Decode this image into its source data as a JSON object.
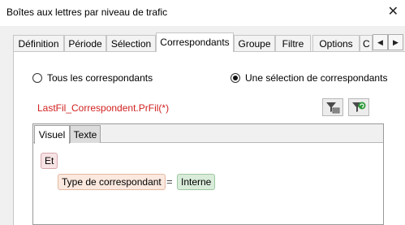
{
  "window": {
    "title": "Boîtes aux lettres par niveau de trafic",
    "close_glyph": "✕"
  },
  "tabs": [
    {
      "label": "Définition"
    },
    {
      "label": "Période"
    },
    {
      "label": "Sélection"
    },
    {
      "label": "Correspondants",
      "active": true
    },
    {
      "label": "Groupe"
    },
    {
      "label": "Filtre"
    },
    {
      "label": "Options"
    },
    {
      "label": "C"
    }
  ],
  "tab_scroll": {
    "left_glyph": "◀",
    "right_glyph": "▶"
  },
  "radios": {
    "all_label": "Tous les correspondants",
    "selection_label": "Une sélection de correspondants",
    "selected": "selection"
  },
  "expression": "LastFil_Correspondent.PrFil(*)",
  "toolbar": {
    "filter_icon": "filter-edit-icon",
    "filter_clear_icon": "filter-refresh-icon"
  },
  "editor_tabs": {
    "visual": "Visuel",
    "text": "Texte",
    "active": "visual"
  },
  "condition": {
    "operator": "Et",
    "field": "Type de correspondant",
    "comparator": "=",
    "value": "Interne"
  },
  "colors": {
    "expression": "#d22020",
    "and_chip": "#f7e2e4",
    "field_chip": "#fbe8de",
    "value_chip": "#d9ecda"
  }
}
